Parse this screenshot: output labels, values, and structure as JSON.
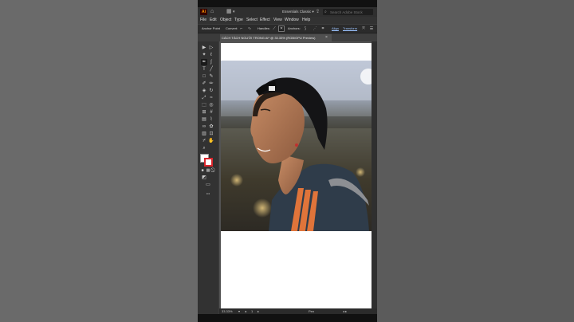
{
  "app": {
    "logo": "Ai",
    "workspace": "Essentials Classic",
    "search_placeholder": "Search Adobe Stock"
  },
  "menu": [
    "File",
    "Edit",
    "Object",
    "Type",
    "Select",
    "Effect",
    "View",
    "Window",
    "Help"
  ],
  "control_bar": {
    "anchor_point": "Anchor Point",
    "convert": "Convert:",
    "handles": "Handles:",
    "anchors": "Anchors:",
    "align": "Align",
    "transform": "Transform"
  },
  "document_tab": {
    "title": "CÁCH TÁCH NGƯỜI TRONG AI* @ 33.33% (RGB/GPU Preview)",
    "close": "×"
  },
  "status": {
    "zoom": "33.33%",
    "artboard_number": "1",
    "tool_name": "Pen"
  },
  "toolbar_icons": [
    "selection-tool",
    "direct-selection-tool",
    "magic-wand-tool",
    "lasso-tool",
    "pen-tool",
    "curvature-tool",
    "type-tool",
    "line-tool",
    "rectangle-tool",
    "paintbrush-tool",
    "shaper-tool",
    "pencil-tool",
    "eraser-tool",
    "rotate-tool",
    "scale-tool",
    "warp-tool",
    "free-transform-tool",
    "shape-builder-tool",
    "perspective-tool",
    "mesh-tool",
    "gradient-tool",
    "eyedropper-tool",
    "blend-tool",
    "symbol-sprayer-tool",
    "graph-tool",
    "artboard-tool",
    "slice-tool",
    "hand-tool",
    "zoom-tool"
  ],
  "colors": {
    "app_bg": "#3b3b3b",
    "panel": "#323232",
    "accent_link": "#9bc3ff",
    "fill_swatch": "#ffffff",
    "stroke_swatch": "#d9262c"
  }
}
